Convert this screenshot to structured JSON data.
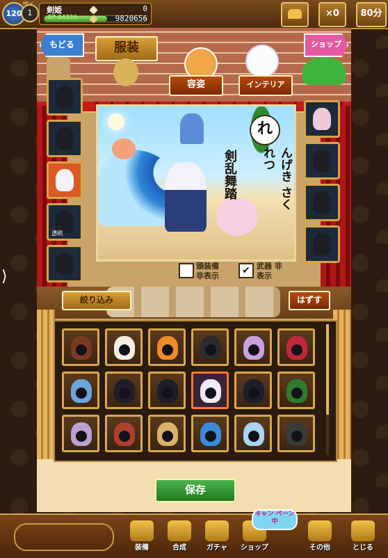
{
  "player": {
    "level": "120",
    "mlv_tag": "MLv",
    "mlv": "1",
    "name": "剣姫",
    "ep_label": "EP",
    "ep_value": "24326",
    "ep_fill_fraction": 0.62,
    "currency_top": "0",
    "currency_bottom": "9820656"
  },
  "topbar": {
    "ticket_count": "×0",
    "time": "80分"
  },
  "header": {
    "back_label": "もどる",
    "tab_costume": "服装",
    "tab_appearance": "容姿",
    "tab_interior": "インテリア",
    "shop_label": "ショップ"
  },
  "scene": {
    "badge": "れ",
    "skill_reading": "んげき さくれつ",
    "skill_name": "剣乱舞踏"
  },
  "left_slots": [
    {
      "name": "outfit-slot-coat",
      "active": false,
      "label": ""
    },
    {
      "name": "outfit-slot-pants",
      "active": false,
      "label": ""
    },
    {
      "name": "outfit-slot-head",
      "active": true,
      "label": ""
    },
    {
      "name": "outfit-slot-accessory",
      "active": false,
      "label": "透明"
    },
    {
      "name": "outfit-slot-shoes",
      "active": false,
      "label": ""
    }
  ],
  "right_slots": [
    {
      "name": "outfit-slot-weapon",
      "active": false
    },
    {
      "name": "outfit-slot-hair",
      "active": false
    },
    {
      "name": "outfit-slot-body",
      "active": false
    },
    {
      "name": "outfit-slot-pose",
      "active": false
    }
  ],
  "toggles": {
    "head_hide_label": "頭装備 非表示",
    "head_hide_checked": false,
    "weapon_hide_label": "武器 非表示",
    "weapon_hide_checked": true
  },
  "filter": {
    "filter_label": "絞り込み",
    "remove_label": "はずす"
  },
  "items_grid": [
    {
      "name": "item-hood-brown",
      "color": "#7b3b22"
    },
    {
      "name": "item-cap-white",
      "color": "#f4efe2"
    },
    {
      "name": "item-hood-orange",
      "color": "#ef8a2a"
    },
    {
      "name": "item-helmet-horn",
      "color": "#2b2b2b"
    },
    {
      "name": "item-hat-top-gold",
      "color": "#c8a2e0"
    },
    {
      "name": "item-hair-red",
      "color": "#c0283a"
    },
    {
      "name": "item-crown-blue",
      "color": "#6aa6d9"
    },
    {
      "name": "item-horn-red",
      "color": "#1e1e28"
    },
    {
      "name": "item-hood-dark",
      "color": "#1e1e28"
    },
    {
      "name": "item-hood-cat-white",
      "color": "#f0eaf8"
    },
    {
      "name": "item-hood-pink-star",
      "color": "#1e1e28"
    },
    {
      "name": "item-wreath-green",
      "color": "#2f7a2f"
    },
    {
      "name": "item-hood-lavender",
      "color": "#b9a2cf"
    },
    {
      "name": "item-hair-red-braid",
      "color": "#b0402a"
    },
    {
      "name": "item-strawhat",
      "color": "#d8b26a"
    },
    {
      "name": "item-bow-blue",
      "color": "#3a8ae0"
    },
    {
      "name": "item-cap-lightblue",
      "color": "#a9d4ef"
    },
    {
      "name": "item-mask-demon",
      "color": "#3a3a3a"
    }
  ],
  "selected_item_index": 9,
  "save_label": "保存",
  "nav": {
    "campaign_label": "キャン ペーン中",
    "items": [
      {
        "name": "nav-equip",
        "label": "装備"
      },
      {
        "name": "nav-synthesis",
        "label": "合成"
      },
      {
        "name": "nav-gacha",
        "label": "ガチャ"
      },
      {
        "name": "nav-shop",
        "label": "ショップ"
      },
      {
        "name": "nav-other",
        "label": "その他"
      },
      {
        "name": "nav-close",
        "label": "とじる"
      }
    ]
  },
  "colors": {
    "accent_gold": "#e4c16a",
    "curtain_red": "#b11616",
    "save_green": "#2f9a2f"
  }
}
